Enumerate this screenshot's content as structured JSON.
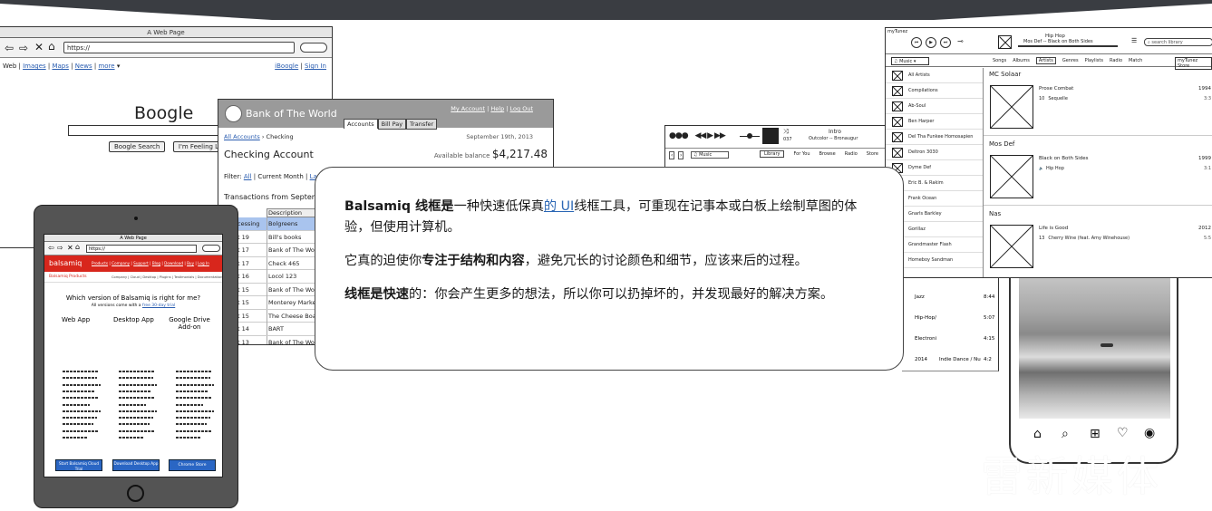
{
  "browser": {
    "title": "A Web Page",
    "url": "https://",
    "links": {
      "web": "Web",
      "images": "Images",
      "maps": "Maps",
      "news": "News",
      "more": "more",
      "iboogle": "iBoogle",
      "signin": "Sign In"
    },
    "logo": "Boogle",
    "search_btn": "Boogle Search",
    "lucky_btn": "I'm Feeling Lucky"
  },
  "bank": {
    "name": "Bank of The World",
    "links": {
      "account": "My Account",
      "help": "Help",
      "logout": "Log Out"
    },
    "tabs": [
      "Accounts",
      "Bill Pay",
      "Transfer"
    ],
    "breadcrumb_link": "All Accounts",
    "breadcrumb_current": "Checking",
    "date": "September 19th, 2013",
    "title": "Checking Account",
    "balance_label": "Available balance",
    "balance": "$4,217.48",
    "filter_label": "Filter:",
    "filter_all": "All",
    "filter_month": "Current Month",
    "filter_last": "La",
    "transactions_title": "Transactions from September",
    "col_desc": "Description",
    "rows": [
      {
        "d": "cessing",
        "desc": "Bolgreens"
      },
      {
        "d": "t 19",
        "desc": "Bill's books"
      },
      {
        "d": "t 17",
        "desc": "Bank of The World"
      },
      {
        "d": "t 17",
        "desc": "Check 465"
      },
      {
        "d": "t 16",
        "desc": "Locol 123"
      },
      {
        "d": "t 15",
        "desc": "Bank of The World"
      },
      {
        "d": "t 15",
        "desc": "Monterey Market"
      },
      {
        "d": "t 15",
        "desc": "The Cheese Board"
      },
      {
        "d": "t 14",
        "desc": "BART"
      },
      {
        "d": "t 13",
        "desc": "Bank of The World"
      }
    ]
  },
  "tablet": {
    "title": "A Web Page",
    "url": "https://",
    "brand": "balsamiq",
    "nav": [
      "Products",
      "Company",
      "Support",
      "Blog",
      "Download",
      "Buy",
      "Log In"
    ],
    "subnav_left": "Balsamiq Products",
    "subnav": [
      "Company",
      "Cloud",
      "Desktop",
      "Plugins",
      "Testimonials",
      "Documentation",
      "Forum"
    ],
    "question": "Which version of Balsamiq is right for me?",
    "sub_prefix": "All versions come with a ",
    "sub_link": "free 30-day trial",
    "cols": [
      "Web App",
      "Desktop App",
      "Google Drive Add-on"
    ],
    "buttons": [
      "Start Balsamiq Cloud Trial",
      "Download Desktop App",
      "Chrome Store"
    ]
  },
  "player": {
    "track": "Intro",
    "artist": "Outcolor -- Bronaugur",
    "time": "037",
    "source": "Music",
    "tabs": [
      "Library",
      "For You",
      "Browse",
      "Radio",
      "Store"
    ]
  },
  "itunes": {
    "app": "myTunez",
    "song": "Hip Hop",
    "artist": "Mos Def -- Black on Both Sides",
    "search": "search library",
    "tabs": [
      "Songs",
      "Albums",
      "Artists",
      "Genres",
      "Playlists",
      "Radio",
      "Match"
    ],
    "store": "myTunez Store",
    "source": "Music",
    "artists": [
      "All Artists",
      "Compilations",
      "Ab-Soul",
      "Ben Harper",
      "Del Tha Funkee Homosapien",
      "Deltron 3030",
      "Dyme Def",
      "Eric B. & Rakim",
      "Frank Ocean",
      "Gnarls Barkley",
      "Gorillaz",
      "Grandmaster Flash",
      "Homeboy Sandman"
    ],
    "albums": [
      {
        "artist": "MC Solaar",
        "album": "Prose Combat",
        "num": "10",
        "track": "Sequelle",
        "year": "1994",
        "dur": "3:3"
      },
      {
        "artist": "Mos Def",
        "album": "Black on Both Sides",
        "num": "",
        "track": "Hip Hop",
        "year": "1999",
        "dur": "3:1"
      },
      {
        "artist": "Nas",
        "album": "Life is Good",
        "num": "13",
        "track": "Cherry Wine (feat. Amy Winehouse)",
        "year": "2012",
        "dur": "5:5"
      }
    ]
  },
  "genres": [
    {
      "g": "Jazz",
      "n": "",
      "v": "8:44"
    },
    {
      "g": "Hip-Hop/",
      "n": "",
      "v": "5:07"
    },
    {
      "g": "Electroni",
      "n": "",
      "v": "4:15"
    },
    {
      "g": "2014",
      "n": "Indie Dance / Nu",
      "v": "4:2"
    }
  ],
  "card": {
    "p1_b": "Balsamiq 线框是",
    "p1_t1": "一种快速低保真",
    "p1_link": "的 UI",
    "p1_t2": "线框工具，可重现在记事本或白板上绘制草图的体验，但使用计算机。",
    "p2_t1": "它真的迫使你",
    "p2_b": "专注于结构和内容",
    "p2_t2": "，避免冗长的讨论颜色和细节，应该来后的过程。",
    "p3_b": "线框是快速",
    "p3_t": "的：你会产生更多的想法，所以你可以扔掉坏的，并发现最好的解决方案。"
  },
  "watermark": "雷新媒体",
  "colors": {
    "band": "#3a3d42",
    "bank_header": "#9a9a9a",
    "balsamiq_red": "#d8261c",
    "link": "#2a66b4",
    "device": "#545454"
  }
}
